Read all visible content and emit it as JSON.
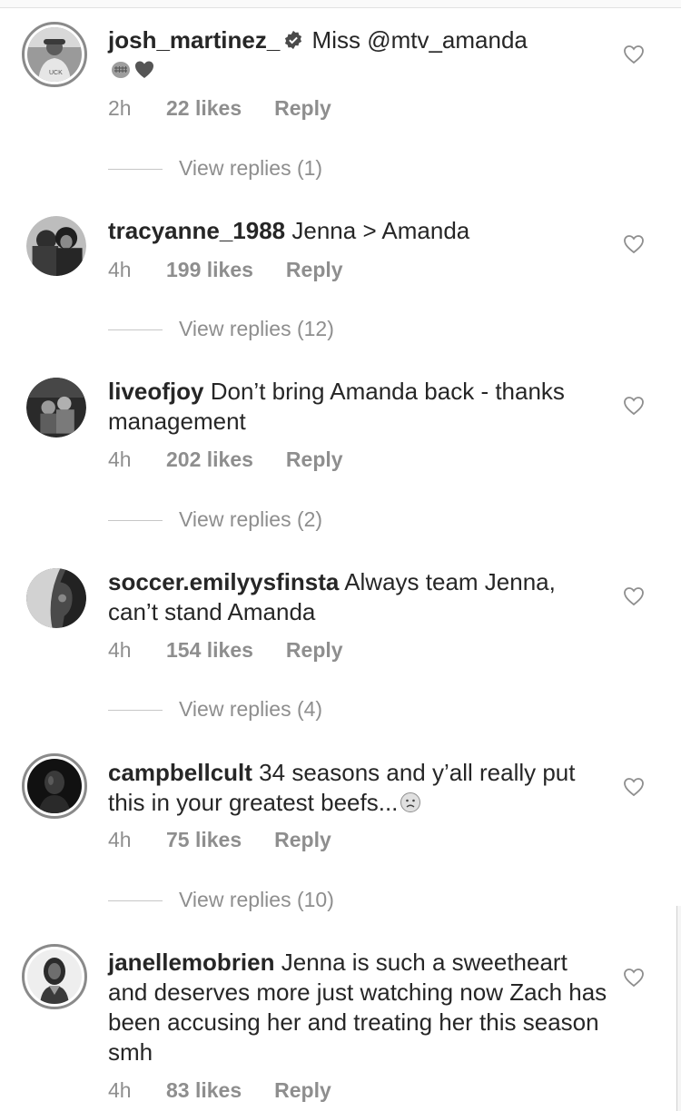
{
  "comments": [
    {
      "username": "josh_martinez_",
      "verified": true,
      "text": "Miss @mtv_amanda",
      "emojis": [
        "fist-emoji",
        "heart-emoji"
      ],
      "time": "2h",
      "likes": "22 likes",
      "reply": "Reply",
      "view_replies": "View replies (1)",
      "avatar_ring": true
    },
    {
      "username": "tracyanne_1988",
      "verified": false,
      "text": "Jenna > Amanda",
      "time": "4h",
      "likes": "199 likes",
      "reply": "Reply",
      "view_replies": "View replies (12)",
      "avatar_ring": false
    },
    {
      "username": "liveofjoy",
      "verified": false,
      "text": "Don’t bring Amanda back - thanks management",
      "time": "4h",
      "likes": "202 likes",
      "reply": "Reply",
      "view_replies": "View replies (2)",
      "avatar_ring": false
    },
    {
      "username": "soccer.emilyysfinsta",
      "verified": false,
      "text": "Always team Jenna, can’t stand Amanda",
      "time": "4h",
      "likes": "154 likes",
      "reply": "Reply",
      "view_replies": "View replies (4)",
      "avatar_ring": false
    },
    {
      "username": "campbellcult",
      "verified": false,
      "text": "34 seasons and y’all really put this in your greatest beefs...",
      "emojis": [
        "frowning-face-emoji"
      ],
      "time": "4h",
      "likes": "75 likes",
      "reply": "Reply",
      "view_replies": "View replies (10)",
      "avatar_ring": true
    },
    {
      "username": "janellemobrien",
      "verified": false,
      "text": "Jenna is such a sweetheart and deserves more just watching now Zach has been accusing her and treating her this season smh",
      "time": "4h",
      "likes": "83 likes",
      "reply": "Reply",
      "avatar_ring": true
    }
  ],
  "icons": {
    "like": "heart-outline-icon",
    "verified": "verified-badge-icon"
  },
  "colors": {
    "text": "#262626",
    "meta": "#8e8e8e",
    "divider": "#c7c7c7"
  }
}
